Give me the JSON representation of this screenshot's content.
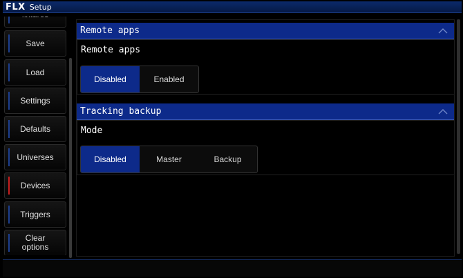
{
  "app": {
    "brand": "FLX",
    "title": "Setup"
  },
  "sidebar": {
    "items": [
      {
        "label": "fixtures",
        "active": false
      },
      {
        "label": "Save",
        "active": false
      },
      {
        "label": "Load",
        "active": false
      },
      {
        "label": "Settings",
        "active": false
      },
      {
        "label": "Defaults",
        "active": false
      },
      {
        "label": "Universes",
        "active": false
      },
      {
        "label": "Devices",
        "active": true
      },
      {
        "label": "Triggers",
        "active": false
      },
      {
        "label": "Clear\noptions",
        "active": false
      }
    ]
  },
  "panels": [
    {
      "title": "Remote apps",
      "label": "Remote apps",
      "options": [
        "Disabled",
        "Enabled"
      ],
      "selected": "Disabled"
    },
    {
      "title": "Tracking backup",
      "label": "Mode",
      "options": [
        "Disabled",
        "Master",
        "Backup"
      ],
      "selected": "Disabled"
    }
  ],
  "colors": {
    "accent": "#0d2a8a",
    "active_marker": "#c81e1e",
    "background": "#000000"
  },
  "icons": {
    "collapse": "chevron-up-icon"
  }
}
